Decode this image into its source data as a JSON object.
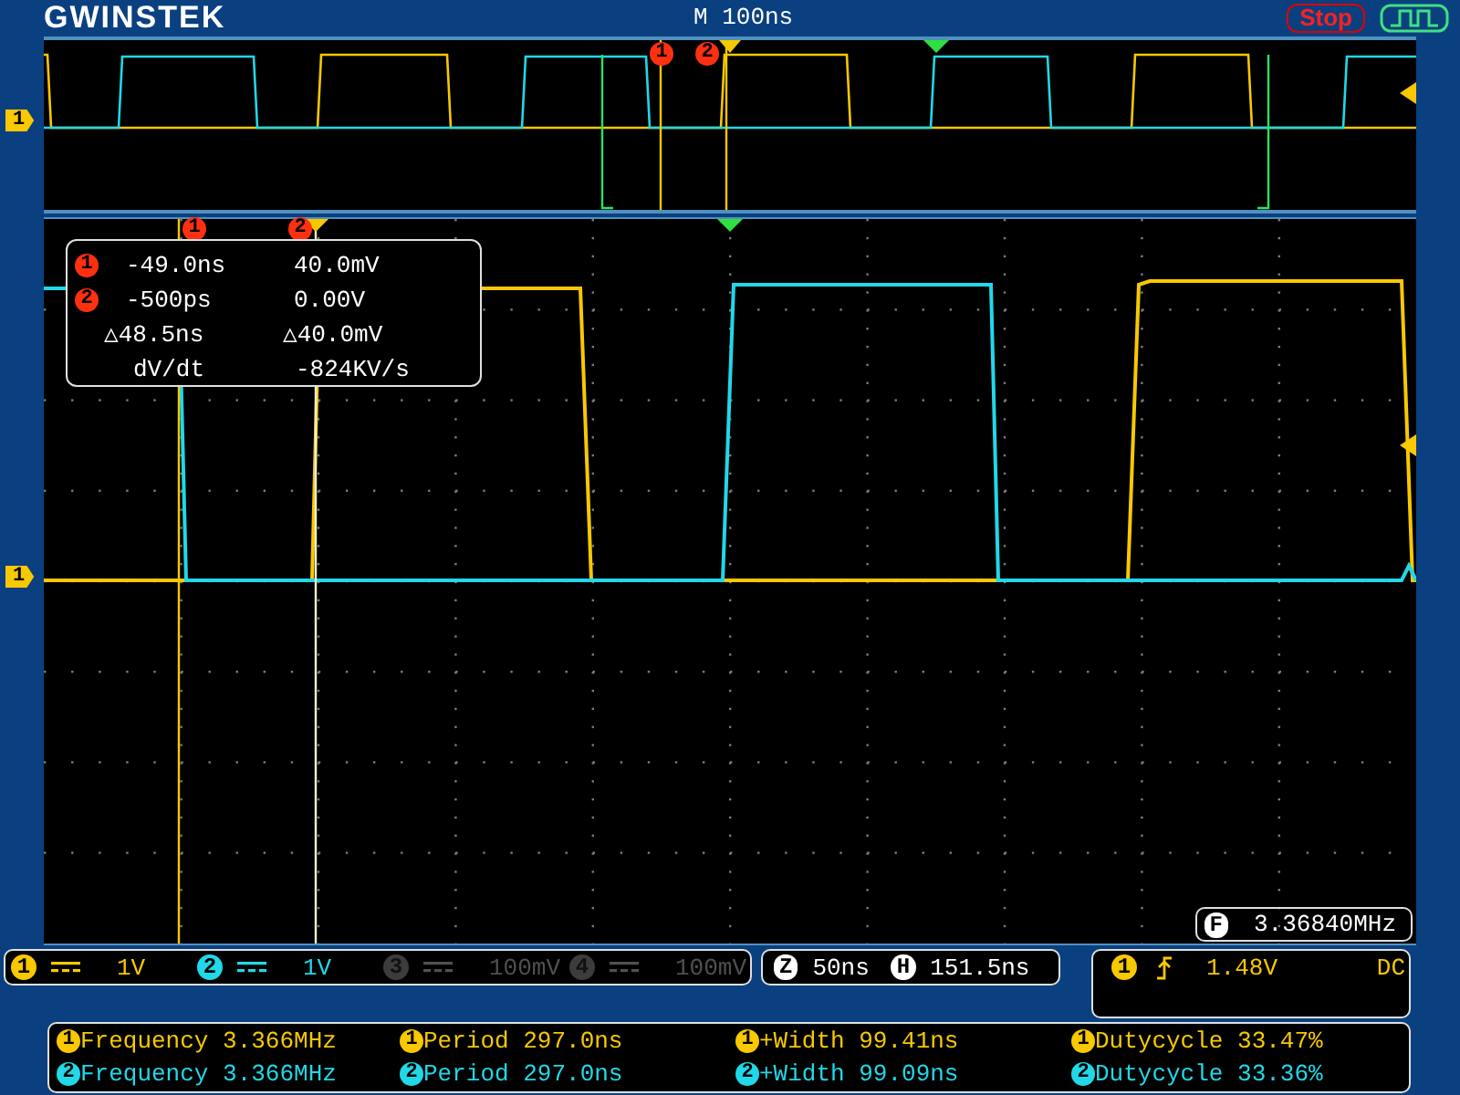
{
  "header": {
    "brand": "GWINSTEK",
    "timebase": "M 100ns",
    "run_state": "Stop"
  },
  "overview": {
    "ground_marker": "1",
    "cursors": [
      "1",
      "2"
    ]
  },
  "main": {
    "ground_marker": "1",
    "cursors": [
      "1",
      "2"
    ]
  },
  "readout": {
    "rows": [
      {
        "marker": "1",
        "time": "-49.0ns",
        "voltage": "40.0mV"
      },
      {
        "marker": "2",
        "time": "-500ps",
        "voltage": "0.00V"
      }
    ],
    "delta": {
      "time": "△48.5ns",
      "voltage": "△40.0mV"
    },
    "slope": {
      "label": "dV/dt",
      "value": "-824KV/s"
    }
  },
  "frequency_counter": {
    "badge": "F",
    "value": "3.36840MHz"
  },
  "channels": [
    {
      "number": "1",
      "scale": "1V",
      "on": true,
      "color": "#f8c800"
    },
    {
      "number": "2",
      "scale": "1V",
      "on": true,
      "color": "#20d8e8"
    },
    {
      "number": "3",
      "scale": "100mV",
      "on": false,
      "color": "#3c3c3c"
    },
    {
      "number": "4",
      "scale": "100mV",
      "on": false,
      "color": "#3c3c3c"
    }
  ],
  "horizontal": {
    "zoom_badge": "Z",
    "zoom_scale": "50ns",
    "position_badge": "H",
    "position": "151.5ns"
  },
  "trigger": {
    "source": "1",
    "level": "1.48V",
    "coupling": "DC"
  },
  "measurements": [
    {
      "color": "#f8c800",
      "items": [
        {
          "channel": "1",
          "text": "Frequency 3.366MHz"
        },
        {
          "channel": "1",
          "text": "Period 297.0ns"
        },
        {
          "channel": "1",
          "text": "+Width 99.41ns"
        },
        {
          "channel": "1",
          "text": "Dutycycle 33.47%"
        }
      ]
    },
    {
      "color": "#20d8e8",
      "items": [
        {
          "channel": "2",
          "text": "Frequency 3.366MHz"
        },
        {
          "channel": "2",
          "text": "Period 297.0ns"
        },
        {
          "channel": "2",
          "text": "+Width 99.09ns"
        },
        {
          "channel": "2",
          "text": "Dutycycle 33.36%"
        }
      ]
    }
  ]
}
